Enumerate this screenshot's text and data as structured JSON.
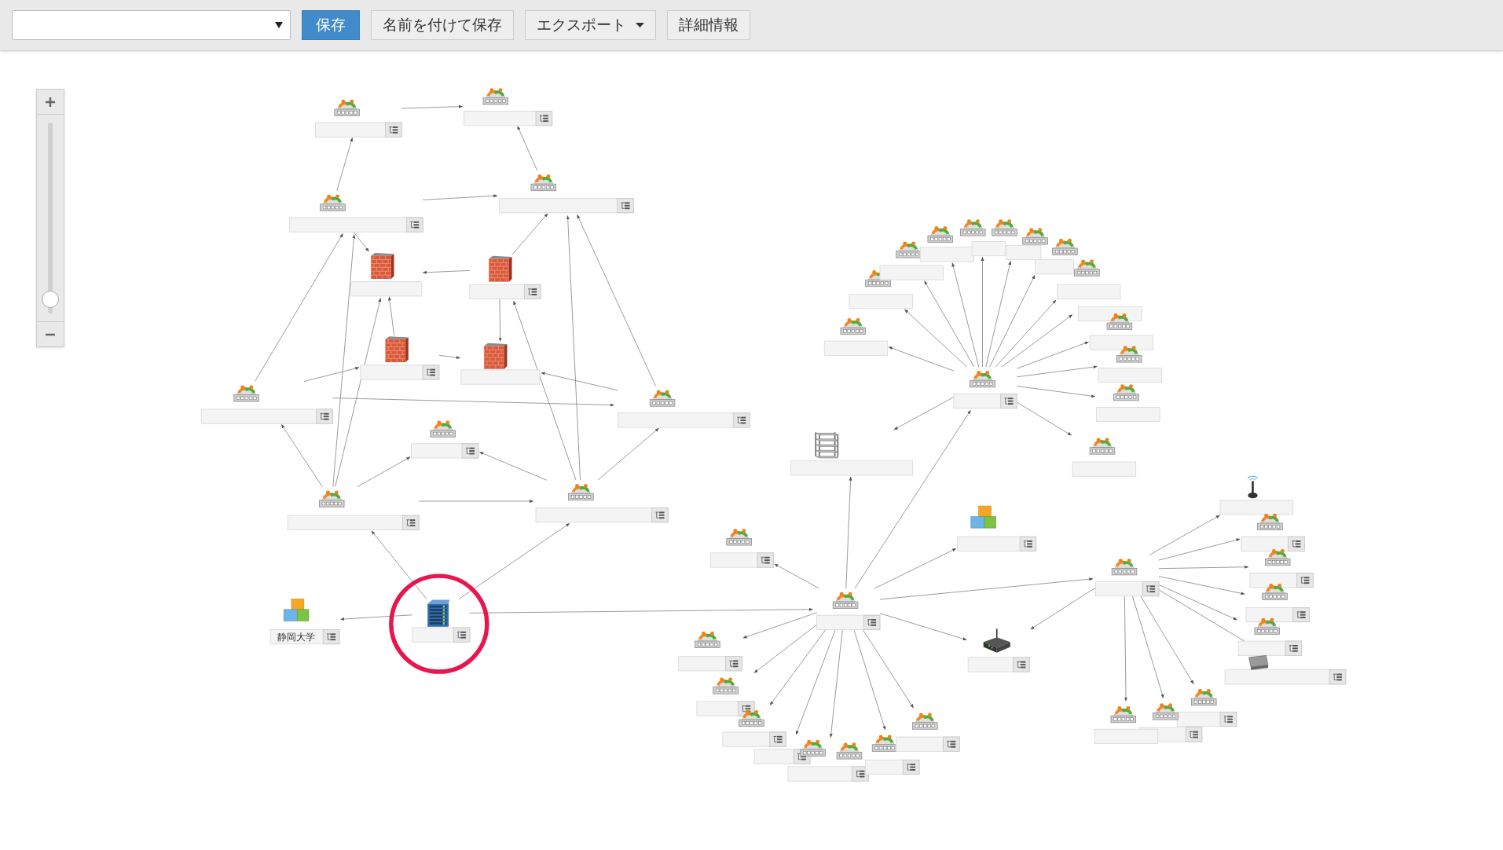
{
  "toolbar": {
    "buttons": [
      {
        "label": "保存",
        "kind": "primary"
      },
      {
        "label": "名前を付けて保存",
        "kind": "plain"
      },
      {
        "label": "エクスポート",
        "kind": "dropdown"
      },
      {
        "label": "詳細情報",
        "kind": "plain"
      }
    ]
  },
  "zoom": {
    "level": 0.03
  },
  "nodes": [
    {
      "kind": "router",
      "has_menu": true
    },
    {
      "kind": "router",
      "has_menu": true
    },
    {
      "kind": "router",
      "has_menu": true
    },
    {
      "kind": "router",
      "has_menu": true
    },
    {
      "kind": "firewall",
      "has_menu": false
    },
    {
      "kind": "firewall",
      "has_menu": true
    },
    {
      "kind": "firewall",
      "has_menu": true
    },
    {
      "kind": "firewall",
      "has_menu": false
    },
    {
      "kind": "router",
      "has_menu": true
    },
    {
      "kind": "router",
      "has_menu": true
    },
    {
      "kind": "router",
      "has_menu": true
    },
    {
      "kind": "router",
      "has_menu": true
    },
    {
      "kind": "router",
      "has_menu": true
    },
    {
      "kind": "server",
      "has_menu": true,
      "highlighted": true
    },
    {
      "kind": "cubes",
      "has_menu": true,
      "label": "静岡大学"
    },
    {
      "kind": "router",
      "has_menu": true
    },
    {
      "kind": "router",
      "has_menu": true
    },
    {
      "kind": "cubes",
      "has_menu": true
    },
    {
      "kind": "shelf",
      "has_menu": false
    },
    {
      "kind": "router",
      "has_menu": true
    },
    {
      "kind": "router",
      "has_menu": true
    },
    {
      "kind": "router",
      "has_menu": true
    },
    {
      "kind": "router",
      "has_menu": true
    },
    {
      "kind": "router",
      "has_menu": true
    },
    {
      "kind": "router",
      "has_menu": true
    },
    {
      "kind": "router",
      "has_menu": true
    },
    {
      "kind": "wireless_router",
      "has_menu": true
    },
    {
      "kind": "router",
      "has_menu": true
    },
    {
      "kind": "router",
      "has_menu": false
    },
    {
      "kind": "router",
      "has_menu": false
    },
    {
      "kind": "router",
      "has_menu": false
    },
    {
      "kind": "router",
      "has_menu": false
    },
    {
      "kind": "router",
      "has_menu": false
    },
    {
      "kind": "router",
      "has_menu": false
    },
    {
      "kind": "router",
      "has_menu": false
    },
    {
      "kind": "router",
      "has_menu": false
    },
    {
      "kind": "router",
      "has_menu": false
    },
    {
      "kind": "router",
      "has_menu": false
    },
    {
      "kind": "router",
      "has_menu": false
    },
    {
      "kind": "router",
      "has_menu": false
    },
    {
      "kind": "router",
      "has_menu": false
    },
    {
      "kind": "router",
      "has_menu": true
    },
    {
      "kind": "antenna",
      "has_menu": false
    },
    {
      "kind": "router",
      "has_menu": true
    },
    {
      "kind": "router",
      "has_menu": true
    },
    {
      "kind": "router",
      "has_menu": true
    },
    {
      "kind": "router",
      "has_menu": true
    },
    {
      "kind": "hub",
      "has_menu": true
    },
    {
      "kind": "router",
      "has_menu": true
    },
    {
      "kind": "router",
      "has_menu": true
    },
    {
      "kind": "router",
      "has_menu": false
    }
  ]
}
